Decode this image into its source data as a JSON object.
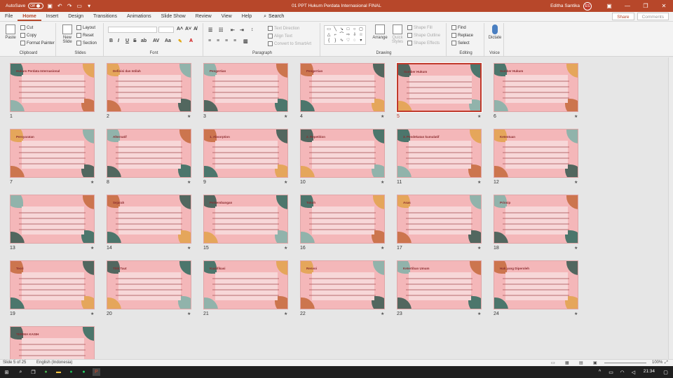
{
  "titlebar": {
    "autosave_label": "AutoSave",
    "autosave_state": "Off",
    "doc_title": "01 PPT Hukum Perdata Internasional FINAL",
    "user_name": "Editha Santika",
    "user_initials": "ES",
    "qa_icons": [
      "save-icon",
      "undo-icon",
      "redo-icon",
      "present-icon",
      "customize-icon"
    ]
  },
  "tabs": [
    "File",
    "Home",
    "Insert",
    "Design",
    "Transitions",
    "Animations",
    "Slide Show",
    "Review",
    "View",
    "Help"
  ],
  "active_tab": "Home",
  "search_label": "Search",
  "share_label": "Share",
  "comments_label": "Comments",
  "ribbon": {
    "clipboard": {
      "label": "Clipboard",
      "paste": "Paste",
      "cut": "Cut",
      "copy": "Copy",
      "format_painter": "Format Painter"
    },
    "slides": {
      "label": "Slides",
      "new_slide": "New Slide",
      "layout": "Layout",
      "reset": "Reset",
      "section": "Section"
    },
    "font": {
      "label": "Font",
      "bold": "B",
      "italic": "I",
      "underline": "U",
      "strike": "S",
      "shadow": "ab"
    },
    "paragraph": {
      "label": "Paragraph",
      "text_direction": "Text Direction",
      "align_text": "Align Text",
      "convert_smartart": "Convert to SmartArt"
    },
    "drawing": {
      "label": "Drawing",
      "arrange": "Arrange",
      "quick_styles": "Quick Styles",
      "shape_fill": "Shape Fill",
      "shape_outline": "Shape Outline",
      "shape_effects": "Shape Effects"
    },
    "editing": {
      "label": "Editing",
      "find": "Find",
      "replace": "Replace",
      "select": "Select"
    },
    "voice": {
      "label": "Voice",
      "dictate": "Dictate"
    }
  },
  "slides": [
    {
      "n": "1",
      "title": "Hukum Perdata Internasional",
      "star": false
    },
    {
      "n": "2",
      "title": "Definisi dan Istilah",
      "star": true
    },
    {
      "n": "3",
      "title": "Pengertian",
      "star": true
    },
    {
      "n": "4",
      "title": "Pengertian",
      "star": true
    },
    {
      "n": "5",
      "title": "Sumber Hukum",
      "star": true
    },
    {
      "n": "6",
      "title": "Sumber Hukum",
      "star": true
    },
    {
      "n": "7",
      "title": "Persyaratan",
      "star": true
    },
    {
      "n": "8",
      "title": "Alternatif",
      "star": true
    },
    {
      "n": "9",
      "title": "1. Absorption",
      "star": true
    },
    {
      "n": "10",
      "title": "2. Repetition",
      "star": true
    },
    {
      "n": "11",
      "title": "3. Pendekatan kumulatif",
      "star": true
    },
    {
      "n": "12",
      "title": "Ketentuan",
      "star": true
    },
    {
      "n": "13",
      "title": "",
      "star": true
    },
    {
      "n": "14",
      "title": "Sejarah",
      "star": true
    },
    {
      "n": "15",
      "title": "Perkembangan",
      "star": true
    },
    {
      "n": "16",
      "title": "Tokoh",
      "star": true
    },
    {
      "n": "17",
      "title": "Asas",
      "star": true
    },
    {
      "n": "18",
      "title": "Prinsip",
      "star": true
    },
    {
      "n": "19",
      "title": "Teori",
      "star": true
    },
    {
      "n": "20",
      "title": "Titik Taut",
      "star": true
    },
    {
      "n": "21",
      "title": "Kualifikasi",
      "star": true
    },
    {
      "n": "22",
      "title": "Renvoi",
      "star": true
    },
    {
      "n": "23",
      "title": "Ketertiban Umum",
      "star": true
    },
    {
      "n": "24",
      "title": "Hak yang Diperoleh",
      "star": true
    },
    {
      "n": "25",
      "title": "TERIMA KASIH",
      "star": false
    }
  ],
  "statusbar": {
    "slide_info": "Slide 5 of 25",
    "language": "English (Indonesia)",
    "zoom": "100%"
  },
  "taskbar": {
    "time": "21:34"
  }
}
